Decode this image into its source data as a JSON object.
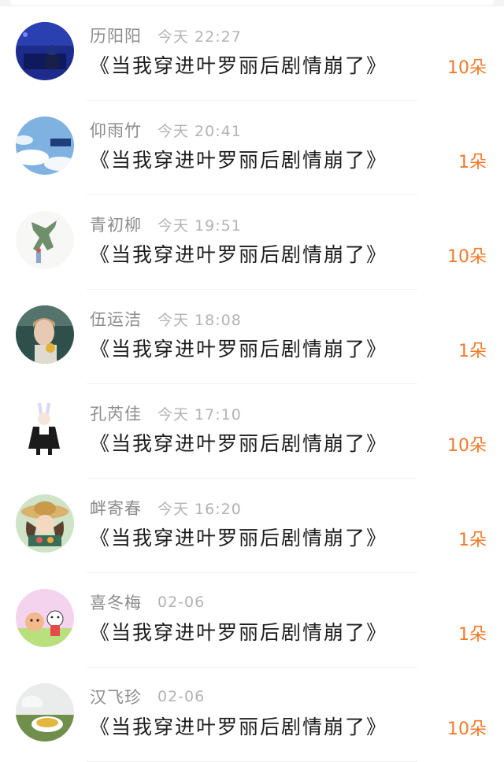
{
  "rows": [
    {
      "name": "历阳阳",
      "time": "今天 22:27",
      "title": "《当我穿进叶罗丽后剧情崩了》",
      "count": "10朵",
      "avatar": "night-room-photo"
    },
    {
      "name": "仰雨竹",
      "time": "今天 20:41",
      "title": "《当我穿进叶罗丽后剧情崩了》",
      "count": "1朵",
      "avatar": "sky-clouds-photo"
    },
    {
      "name": "青初柳",
      "time": "今天 19:51",
      "title": "《当我穿进叶罗丽后剧情崩了》",
      "count": "10朵",
      "avatar": "dancer-figure-drawing"
    },
    {
      "name": "伍运洁",
      "time": "今天 18:08",
      "title": "《当我穿进叶罗丽后剧情崩了》",
      "count": "1朵",
      "avatar": "woman-portrait-photo"
    },
    {
      "name": "孔芮佳",
      "time": "今天 17:10",
      "title": "《当我穿进叶罗丽后剧情崩了》",
      "count": "10朵",
      "avatar": "bunny-girl-illustration"
    },
    {
      "name": "衅寄春",
      "time": "今天 16:20",
      "title": "《当我穿进叶罗丽后剧情崩了》",
      "count": "1朵",
      "avatar": "straw-hat-girl-illustration"
    },
    {
      "name": "喜冬梅",
      "time": "02-06",
      "title": "《当我穿进叶罗丽后剧情崩了》",
      "count": "1朵",
      "avatar": "cartoon-kids-illustration"
    },
    {
      "name": "汉飞珍",
      "time": "02-06",
      "title": "《当我穿进叶罗丽后剧情崩了》",
      "count": "10朵",
      "avatar": "tea-cup-photo"
    }
  ],
  "colors": {
    "name": "#8c8c8c",
    "time": "#b3b3b3",
    "title": "#1c1c1c",
    "count": "#f07a2a",
    "divider": "#f0f0f0"
  }
}
